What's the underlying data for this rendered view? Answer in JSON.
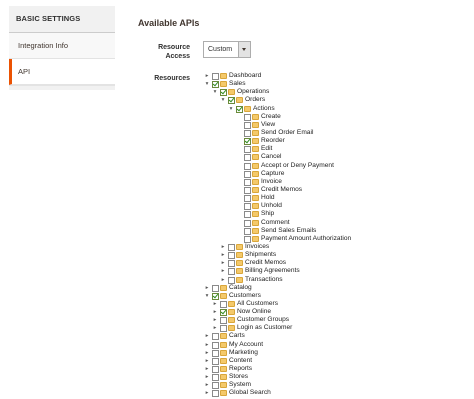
{
  "sidebar": {
    "header": "BASIC SETTINGS",
    "items": [
      {
        "label": "Integration Info",
        "active": false
      },
      {
        "label": "API",
        "active": true
      }
    ],
    "accent_color": "#eb5202"
  },
  "main": {
    "title": "Available APIs",
    "resource_access_label": "Resource Access",
    "resource_access_value": "Custom",
    "resources_label": "Resources"
  },
  "tree": [
    {
      "label": "Dashboard",
      "depth": 0,
      "checked": false,
      "toggle": "▸"
    },
    {
      "label": "Sales",
      "depth": 0,
      "checked": true,
      "toggle": "▾"
    },
    {
      "label": "Operations",
      "depth": 1,
      "checked": true,
      "toggle": "▾"
    },
    {
      "label": "Orders",
      "depth": 2,
      "checked": true,
      "toggle": "▾"
    },
    {
      "label": "Actions",
      "depth": 3,
      "checked": true,
      "toggle": "▾"
    },
    {
      "label": "Create",
      "depth": 4,
      "checked": false,
      "toggle": ""
    },
    {
      "label": "View",
      "depth": 4,
      "checked": false,
      "toggle": ""
    },
    {
      "label": "Send Order Email",
      "depth": 4,
      "checked": false,
      "toggle": ""
    },
    {
      "label": "Reorder",
      "depth": 4,
      "checked": true,
      "toggle": ""
    },
    {
      "label": "Edit",
      "depth": 4,
      "checked": false,
      "toggle": ""
    },
    {
      "label": "Cancel",
      "depth": 4,
      "checked": false,
      "toggle": ""
    },
    {
      "label": "Accept or Deny Payment",
      "depth": 4,
      "checked": false,
      "toggle": ""
    },
    {
      "label": "Capture",
      "depth": 4,
      "checked": false,
      "toggle": ""
    },
    {
      "label": "Invoice",
      "depth": 4,
      "checked": false,
      "toggle": ""
    },
    {
      "label": "Credit Memos",
      "depth": 4,
      "checked": false,
      "toggle": ""
    },
    {
      "label": "Hold",
      "depth": 4,
      "checked": false,
      "toggle": ""
    },
    {
      "label": "Unhold",
      "depth": 4,
      "checked": false,
      "toggle": ""
    },
    {
      "label": "Ship",
      "depth": 4,
      "checked": false,
      "toggle": ""
    },
    {
      "label": "Comment",
      "depth": 4,
      "checked": false,
      "toggle": ""
    },
    {
      "label": "Send Sales Emails",
      "depth": 4,
      "checked": false,
      "toggle": ""
    },
    {
      "label": "Payment Amount Authorization",
      "depth": 4,
      "checked": false,
      "toggle": ""
    },
    {
      "label": "Invoices",
      "depth": 2,
      "checked": false,
      "toggle": "▸"
    },
    {
      "label": "Shipments",
      "depth": 2,
      "checked": false,
      "toggle": "▸"
    },
    {
      "label": "Credit Memos",
      "depth": 2,
      "checked": false,
      "toggle": "▸"
    },
    {
      "label": "Billing Agreements",
      "depth": 2,
      "checked": false,
      "toggle": "▸"
    },
    {
      "label": "Transactions",
      "depth": 2,
      "checked": false,
      "toggle": "▸"
    },
    {
      "label": "Catalog",
      "depth": 0,
      "checked": false,
      "toggle": "▸"
    },
    {
      "label": "Customers",
      "depth": 0,
      "checked": true,
      "toggle": "▾"
    },
    {
      "label": "All Customers",
      "depth": 1,
      "checked": false,
      "toggle": "▸"
    },
    {
      "label": "Now Online",
      "depth": 1,
      "checked": true,
      "toggle": "▸"
    },
    {
      "label": "Customer Groups",
      "depth": 1,
      "checked": false,
      "toggle": "▸"
    },
    {
      "label": "Login as Customer",
      "depth": 1,
      "checked": false,
      "toggle": "▸"
    },
    {
      "label": "Carts",
      "depth": 0,
      "checked": false,
      "toggle": "▸"
    },
    {
      "label": "My Account",
      "depth": 0,
      "checked": false,
      "toggle": "▸"
    },
    {
      "label": "Marketing",
      "depth": 0,
      "checked": false,
      "toggle": "▸"
    },
    {
      "label": "Content",
      "depth": 0,
      "checked": false,
      "toggle": "▸"
    },
    {
      "label": "Reports",
      "depth": 0,
      "checked": false,
      "toggle": "▸"
    },
    {
      "label": "Stores",
      "depth": 0,
      "checked": false,
      "toggle": "▸"
    },
    {
      "label": "System",
      "depth": 0,
      "checked": false,
      "toggle": "▸"
    },
    {
      "label": "Global Search",
      "depth": 0,
      "checked": false,
      "toggle": "▸"
    }
  ]
}
